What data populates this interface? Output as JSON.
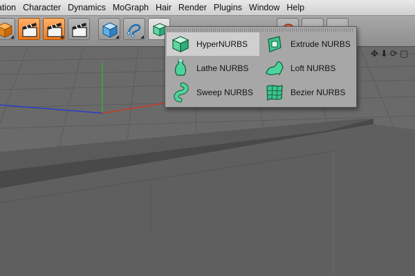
{
  "menubar": {
    "items": [
      "ation",
      "Character",
      "Dynamics",
      "MoGraph",
      "Hair",
      "Render",
      "Plugins",
      "Window",
      "Help"
    ]
  },
  "toolbar": {
    "buttons": [
      {
        "icon": "cube-orange-icon"
      },
      {
        "icon": "clapboard-render-view-icon",
        "state": "selected"
      },
      {
        "icon": "clapboard-render-picture-icon",
        "state": "selected"
      },
      {
        "icon": "clapboard-render-settings-icon"
      },
      {
        "icon": "cube-primitive-icon"
      },
      {
        "icon": "spline-pen-icon"
      },
      {
        "icon": "hypernurbs-icon",
        "state": "active"
      },
      {
        "icon": "deformer-icon"
      },
      {
        "icon": "camera-icon"
      },
      {
        "icon": "light-icon"
      }
    ]
  },
  "popup": {
    "items": [
      {
        "label": "HyperNURBS",
        "icon": "hypernurbs-icon",
        "highlighted": true
      },
      {
        "label": "Extrude NURBS",
        "icon": "extrude-nurbs-icon"
      },
      {
        "label": "Lathe NURBS",
        "icon": "lathe-nurbs-icon"
      },
      {
        "label": "Loft NURBS",
        "icon": "loft-nurbs-icon"
      },
      {
        "label": "Sweep NURBS",
        "icon": "sweep-nurbs-icon"
      },
      {
        "label": "Bezier NURBS",
        "icon": "bezier-nurbs-icon"
      }
    ]
  },
  "viewport": {
    "nav_icons": [
      "move-view-icon",
      "down-arrow-icon",
      "rotate-view-icon",
      "maximize-view-icon"
    ],
    "colors": {
      "floor": "#6c6c6c",
      "grid": "#5a5a5a",
      "x_axis": "#c83a2a",
      "y_axis": "#3aa83a",
      "z_axis": "#2a3ac8"
    }
  }
}
